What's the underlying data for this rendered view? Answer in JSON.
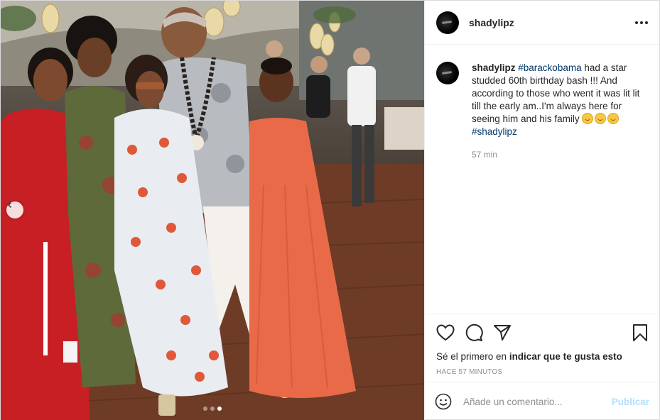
{
  "post": {
    "username": "shadylipz",
    "photo": {
      "carousel_dots": 3,
      "active_dot": 2
    },
    "caption": {
      "username": "shadylipz",
      "tag1": "#barackobama",
      "text": " had a star studded 60th birthday bash !!! And according to those who went it was lit lit till the early am..I'm always here for seeing him and his family ",
      "emoji_count": 3,
      "tag2": "#shadylipz",
      "time": "57 min"
    },
    "actions": {
      "likes_prefix": "Sé el primero en ",
      "likes_link": "indicar que te gusta esto",
      "posted_ago": "HACE 57 MINUTOS"
    },
    "comment_box": {
      "placeholder": "Añade un comentario...",
      "publish_label": "Publicar"
    }
  }
}
